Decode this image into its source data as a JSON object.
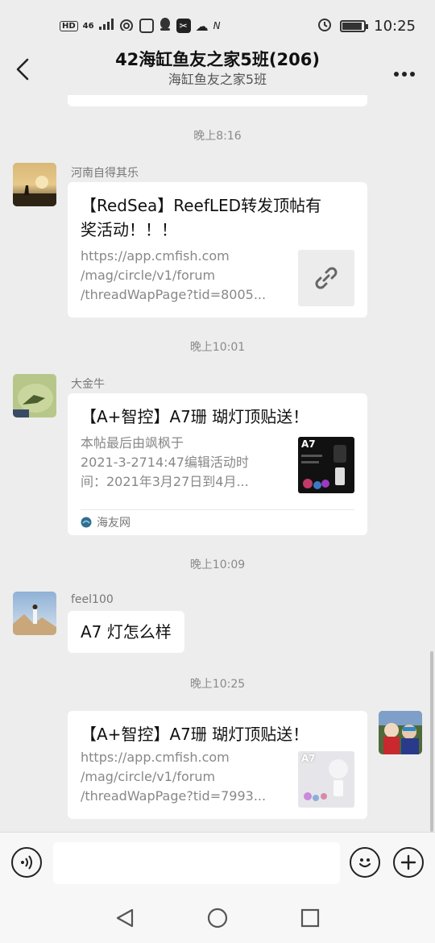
{
  "status_bar": {
    "indicators": [
      "HD",
      "4G",
      "signal-icon",
      "wifi-icon",
      "app-icon",
      "qq-icon",
      "capcut-icon",
      "cloud-icon",
      "nfc-icon"
    ],
    "network_label": "HD",
    "network_type": "46",
    "time": "10:25"
  },
  "header": {
    "title": "42海缸鱼友之家5班(206)",
    "subtitle": "海缸鱼友之家5班",
    "back_icon": "chevron-left-icon",
    "more_icon": "more-dots-icon",
    "more_label": "···"
  },
  "chat": {
    "time_1": "晚上8:16",
    "msg_1": {
      "sender": "河南自得其乐",
      "title": "【RedSea】ReefLED转发顶帖有奖活动！！！",
      "title_line1": "【RedSea】ReefLED转发顶帖有",
      "title_line2": "奖活动！！！",
      "desc_line1": "https://app.cmfish.com",
      "desc_line2": "/mag/circle/v1/forum",
      "desc_line3": "/threadWapPage?tid=8005...",
      "thumb_icon": "link-icon"
    },
    "time_2": "晚上10:01",
    "msg_2": {
      "sender": "大金牛",
      "title": "【A+智控】A7珊 瑚灯顶贴送！",
      "desc_line1": "本帖最后由飒枫于",
      "desc_line2": "2021-3-2714:47编辑活动时",
      "desc_line3": "间：2021年3月27日到4月...",
      "thumb_text": "A7",
      "source": "海友网",
      "source_icon": "haiyouwang-logo-icon"
    },
    "time_3": "晚上10:09",
    "msg_3": {
      "sender": "feel100",
      "text": "A7 灯怎么样"
    },
    "time_4": "晚上10:25",
    "msg_4": {
      "title": "【A+智控】A7珊 瑚灯顶贴送！",
      "desc_line1": "https://app.cmfish.com",
      "desc_line2": "/mag/circle/v1/forum",
      "desc_line3": "/threadWapPage?tid=7993...",
      "thumb_text": "A7"
    }
  },
  "input_bar": {
    "voice_icon": "voice-icon",
    "emoji_icon": "emoji-icon",
    "plus_icon": "plus-icon",
    "input_value": ""
  },
  "nav_bar": {
    "back_icon": "nav-back-icon",
    "home_icon": "nav-home-icon",
    "recents_icon": "nav-recents-icon"
  }
}
